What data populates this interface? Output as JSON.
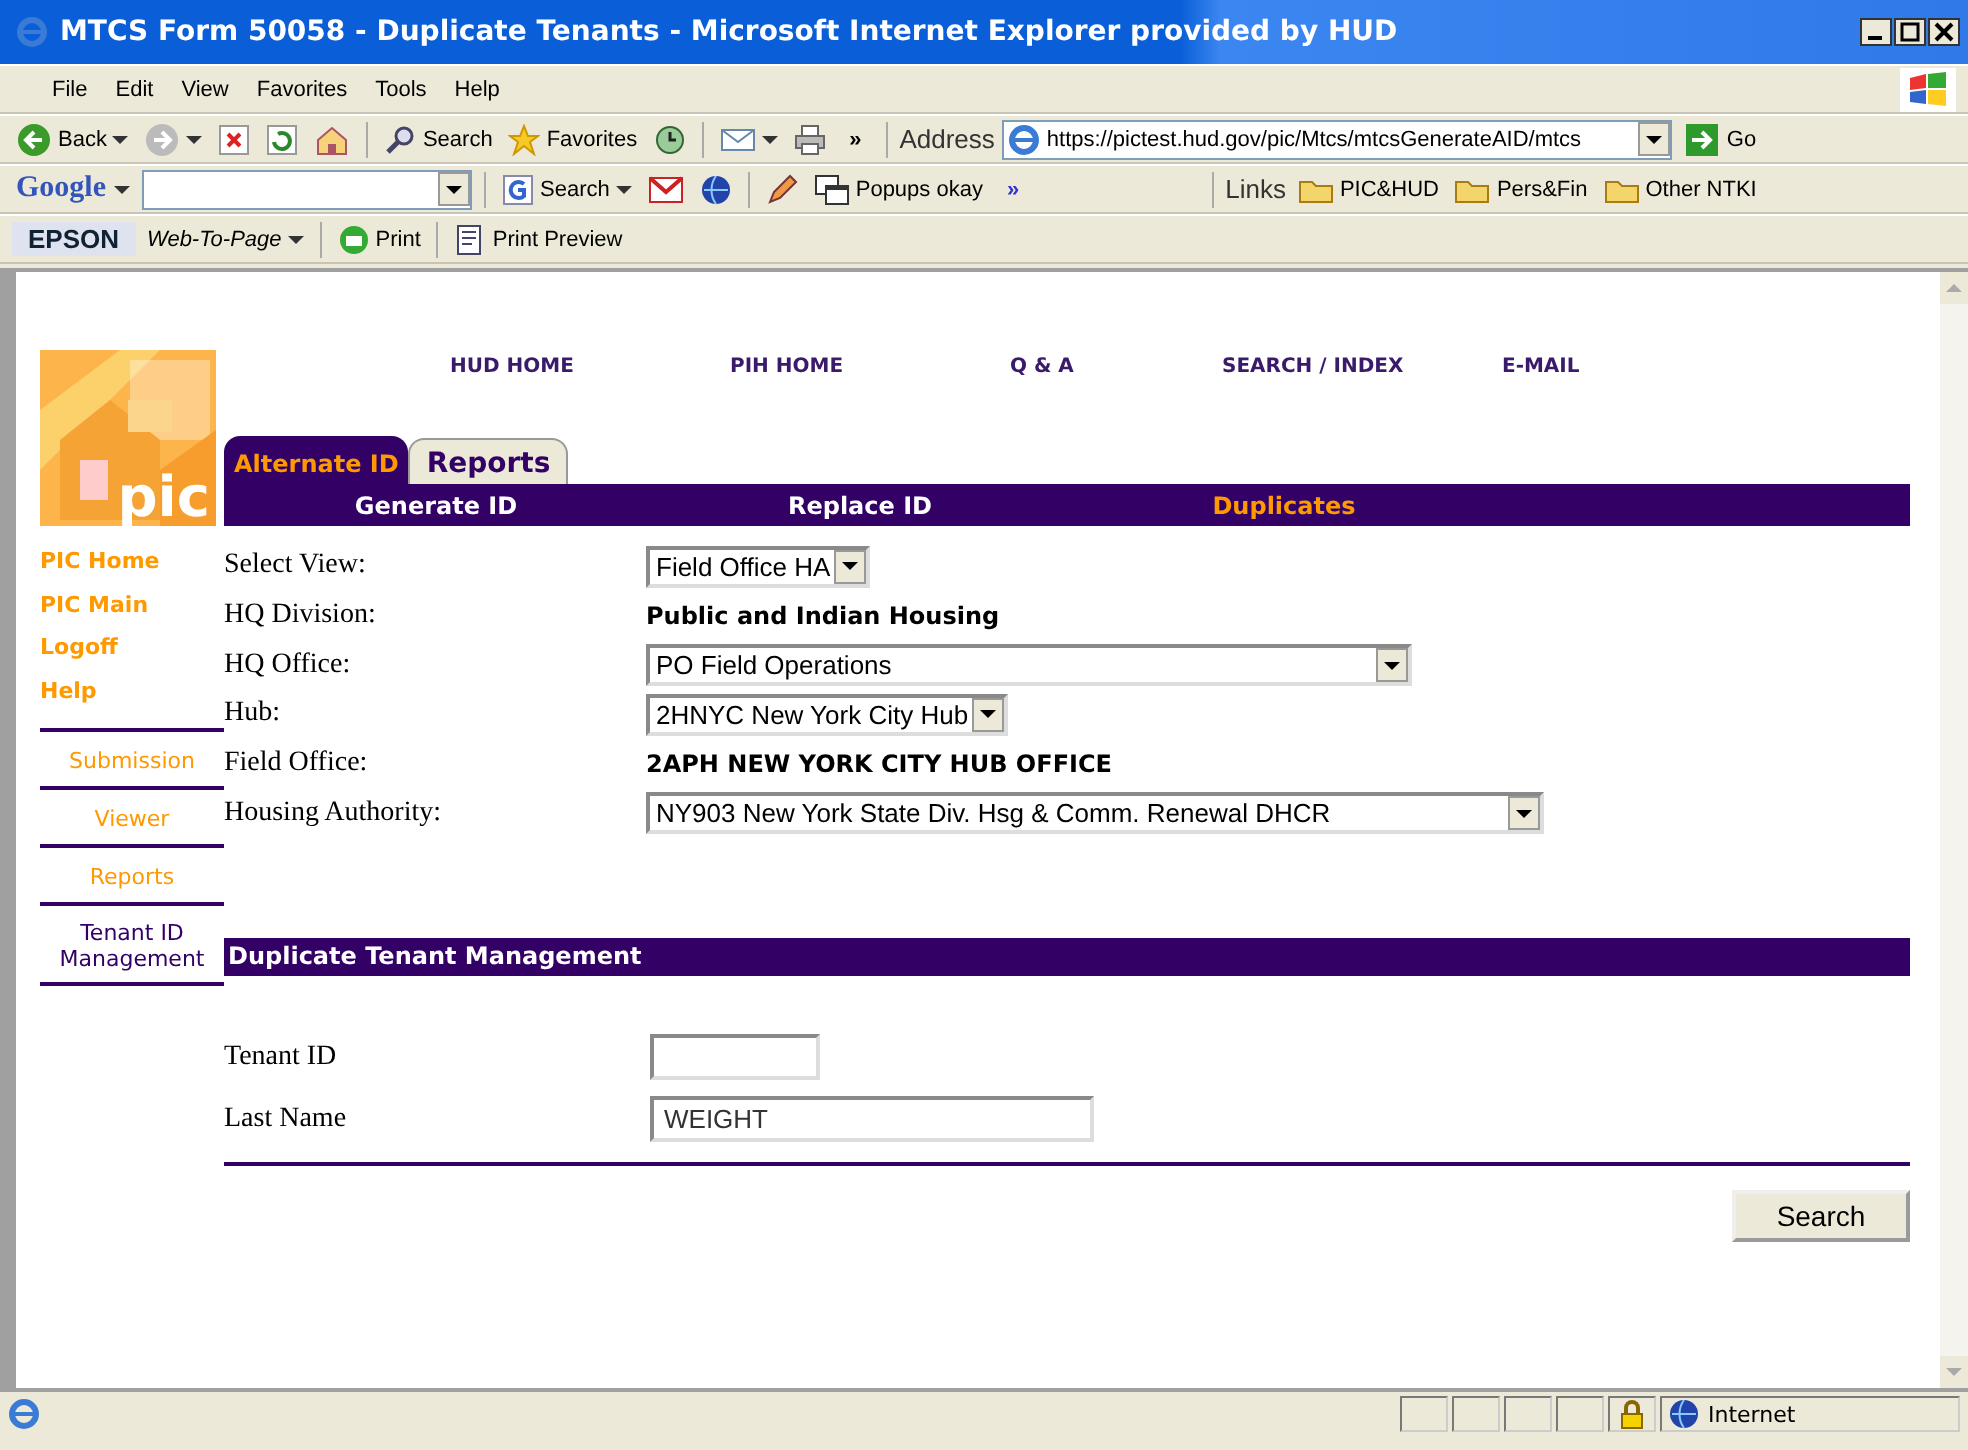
{
  "window": {
    "title": "MTCS Form 50058 - Duplicate Tenants - Microsoft Internet Explorer provided by HUD"
  },
  "menu_bar": [
    "File",
    "Edit",
    "View",
    "Favorites",
    "Tools",
    "Help"
  ],
  "toolbar": {
    "back": "Back",
    "search": "Search",
    "favorites": "Favorites",
    "more": "»",
    "address_label": "Address",
    "url": "https://pictest.hud.gov/pic/Mtcs/mtcsGenerateAID/mtcs",
    "go": "Go"
  },
  "google_bar": {
    "logo": "Google",
    "search": "Search",
    "popups": "Popups okay",
    "more": "»",
    "links_label": "Links",
    "links": [
      "PIC&HUD",
      "Pers&Fin",
      "Other NTKI"
    ]
  },
  "epson_bar": {
    "logo": "EPSON",
    "web_to_page": "Web-To-Page",
    "print": "Print",
    "print_preview": "Print Preview"
  },
  "page": {
    "logo": "pic",
    "top_nav": [
      "HUD HOME",
      "PIH HOME",
      "Q & A",
      "SEARCH / INDEX",
      "E-MAIL"
    ],
    "tabs": [
      {
        "label": "Alternate ID",
        "selected": true
      },
      {
        "label": "Reports",
        "selected": false
      }
    ],
    "sub_tabs": [
      {
        "label": "Generate ID",
        "selected": false
      },
      {
        "label": "Replace ID",
        "selected": false
      },
      {
        "label": "Duplicates",
        "selected": true
      }
    ],
    "sidebar": {
      "links": [
        "PIC Home",
        "PIC Main",
        "Logoff",
        "Help"
      ],
      "sections": [
        {
          "label": "Submission",
          "selected": false
        },
        {
          "label": "Viewer",
          "selected": false
        },
        {
          "label": "Reports",
          "selected": false
        },
        {
          "label": "Tenant ID Management",
          "selected": true
        }
      ]
    },
    "fields": [
      {
        "label": "Select View:",
        "kind": "select",
        "value": "Field Office HA"
      },
      {
        "label": "HQ Division:",
        "kind": "static",
        "value": "Public and Indian Housing"
      },
      {
        "label": "HQ Office:",
        "kind": "select",
        "value": "PO Field Operations"
      },
      {
        "label": "Hub:",
        "kind": "select",
        "value": "2HNYC New York City Hub"
      },
      {
        "label": "Field Office:",
        "kind": "static",
        "value": "2APH NEW YORK CITY HUB OFFICE"
      },
      {
        "label": "Housing Authority:",
        "kind": "select",
        "value": "NY903 New York State Div. Hsg & Comm. Renewal DHCR"
      }
    ],
    "section_title": "Duplicate Tenant Management",
    "search_fields": [
      {
        "label": "Tenant ID"
      },
      {
        "label": "Last Name",
        "value": "WEIGHT"
      }
    ],
    "search_button": "Search"
  },
  "status_bar": {
    "zone": "Internet"
  }
}
